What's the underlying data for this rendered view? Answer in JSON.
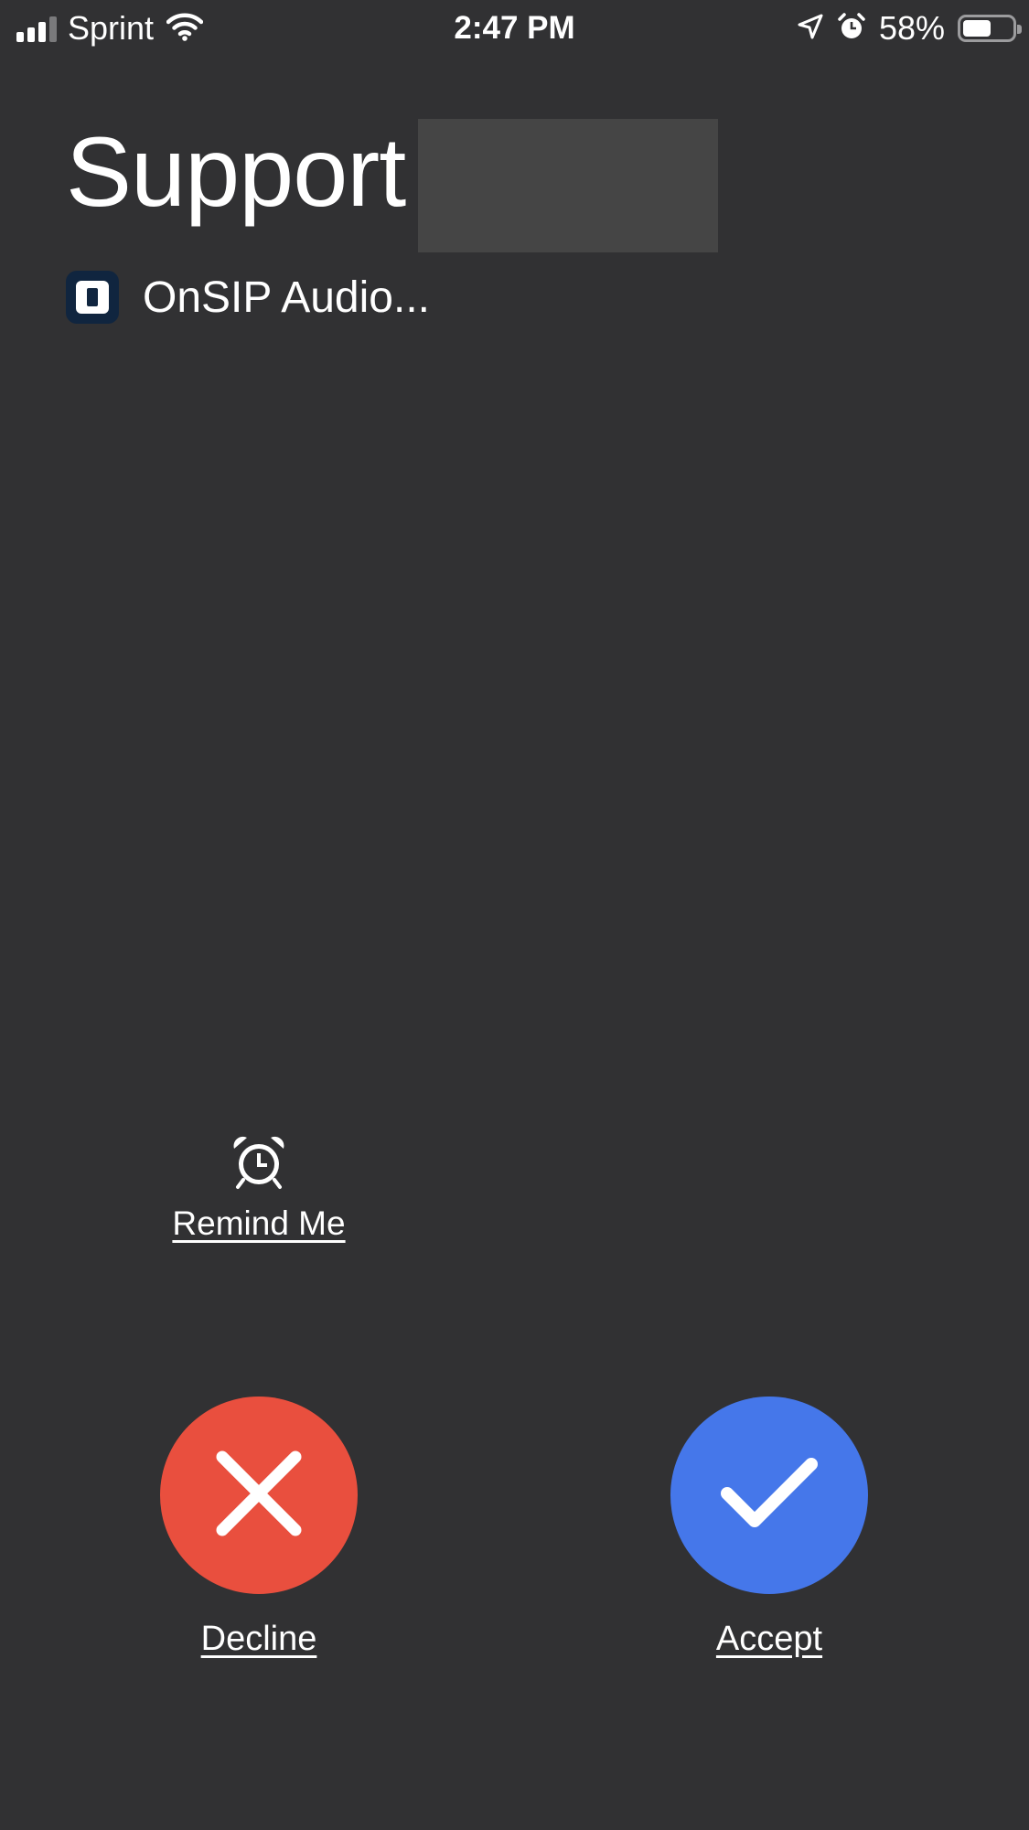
{
  "status_bar": {
    "carrier": "Sprint",
    "time": "2:47 PM",
    "battery_percent_label": "58%",
    "battery_level": 0.58,
    "icons": [
      "signal-icon",
      "wifi-icon",
      "location-icon",
      "alarm-icon",
      "battery-icon"
    ]
  },
  "call": {
    "caller_name": "Support",
    "app_name": "OnSIP Audio..."
  },
  "actions": {
    "remind_label": "Remind Me",
    "decline_label": "Decline",
    "accept_label": "Accept"
  },
  "colors": {
    "background": "#313133",
    "decline": "#e94f3e",
    "accept": "#4577ea",
    "redaction": "#454545"
  }
}
